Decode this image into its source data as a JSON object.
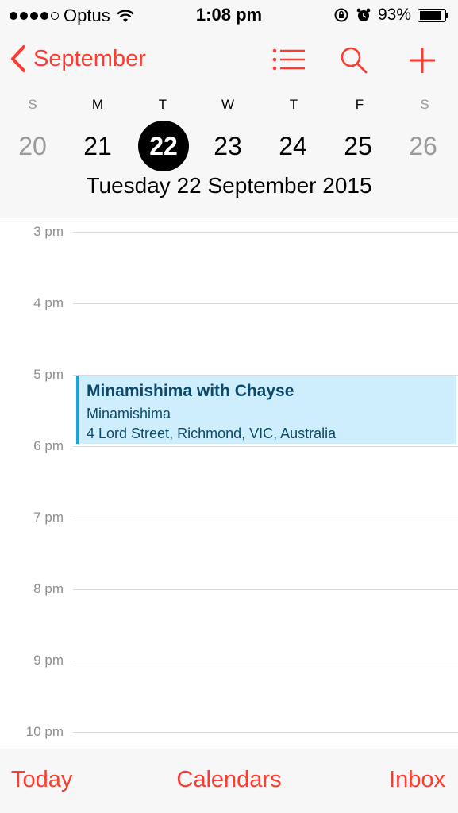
{
  "status_bar": {
    "carrier": "Optus",
    "time": "1:08 pm",
    "battery_percent": "93%",
    "battery_level": 0.93,
    "signal_dots_filled": 4,
    "signal_dots_total": 5
  },
  "nav": {
    "back_label": "September",
    "icons": [
      "list-icon",
      "search-icon",
      "add-icon"
    ]
  },
  "week": {
    "day_letters": [
      "S",
      "M",
      "T",
      "W",
      "T",
      "F",
      "S"
    ],
    "dates": [
      "20",
      "21",
      "22",
      "23",
      "24",
      "25",
      "26"
    ],
    "selected_date": "22",
    "full_date": "Tuesday  22 September 2015"
  },
  "timeline": {
    "hours": [
      "3 pm",
      "4 pm",
      "5 pm",
      "6 pm",
      "7 pm",
      "8 pm",
      "9 pm",
      "10 pm"
    ]
  },
  "event": {
    "title": "Minamishima with Chayse",
    "subtitle": "Minamishima",
    "location": "4 Lord Street, Richmond, VIC, Australia"
  },
  "tabbar": {
    "today": "Today",
    "calendars": "Calendars",
    "inbox": "Inbox"
  },
  "colors": {
    "accent": "#ff3b30",
    "event_bg": "#cfeefd",
    "event_bar": "#1ba1e2",
    "event_text": "#0b4a6c"
  }
}
